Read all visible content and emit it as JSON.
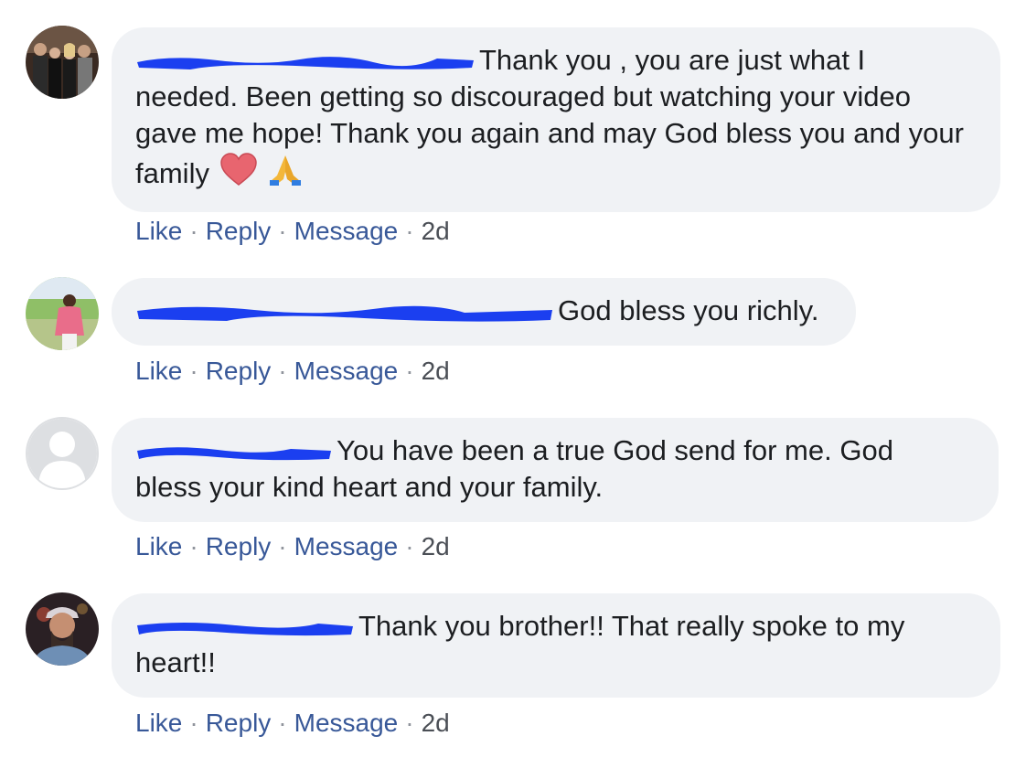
{
  "comments": [
    {
      "text_first": "Thank you , you are just what I",
      "text_rest": "needed. Been getting so discouraged but watching your video gave me hope! Thank you again and may God bless you and your family",
      "emojis": [
        "red-heart",
        "folded-hands"
      ],
      "actions": {
        "like": "Like",
        "reply": "Reply",
        "message": "Message",
        "time": "2d"
      }
    },
    {
      "text_first": "God bless you richly.",
      "actions": {
        "like": "Like",
        "reply": "Reply",
        "message": "Message",
        "time": "2d"
      }
    },
    {
      "text_first": "You have been a true God send for me. God",
      "text_rest": "bless your kind heart and your family.",
      "actions": {
        "like": "Like",
        "reply": "Reply",
        "message": "Message",
        "time": "2d"
      }
    },
    {
      "text_first": "Thank you brother!! That really spoke to my",
      "text_rest": "heart!!",
      "actions": {
        "like": "Like",
        "reply": "Reply",
        "message": "Message",
        "time": "2d"
      }
    }
  ],
  "colors": {
    "bubble_bg": "#f0f2f5",
    "link": "#385898",
    "redaction": "#1b3ff0"
  }
}
